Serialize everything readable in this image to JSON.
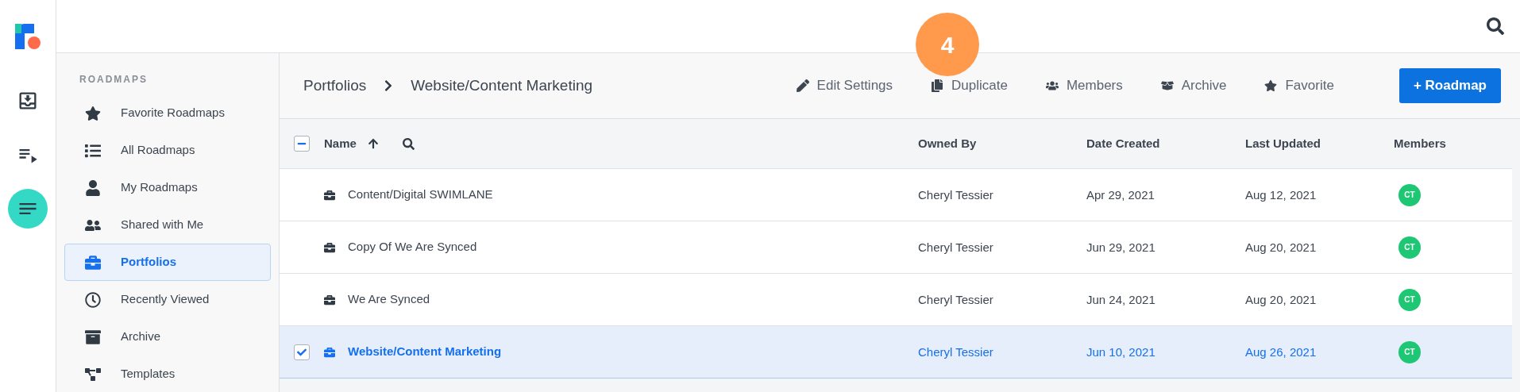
{
  "rail": [
    {
      "kind": "import",
      "selected": false
    },
    {
      "kind": "changelog",
      "selected": false
    },
    {
      "kind": "roadmaps",
      "selected": true
    }
  ],
  "sidebar": {
    "heading": "ROADMAPS",
    "items": [
      {
        "kind": "star",
        "label": "Favorite Roadmaps",
        "selected": false
      },
      {
        "kind": "list",
        "label": "All Roadmaps",
        "selected": false
      },
      {
        "kind": "user",
        "label": "My Roadmaps",
        "selected": false
      },
      {
        "kind": "users",
        "label": "Shared with Me",
        "selected": false
      },
      {
        "kind": "briefcase",
        "label": "Portfolios",
        "selected": true
      },
      {
        "kind": "clock",
        "label": "Recently Viewed",
        "selected": false
      },
      {
        "kind": "archive",
        "label": "Archive",
        "selected": false
      },
      {
        "kind": "templates",
        "label": "Templates",
        "selected": false
      }
    ]
  },
  "toolbar": {
    "breadcrumb": [
      "Portfolios",
      "Website/Content Marketing"
    ],
    "actions": [
      {
        "kind": "edit",
        "label": "Edit Settings"
      },
      {
        "kind": "duplicate",
        "label": "Duplicate"
      },
      {
        "kind": "members",
        "label": "Members"
      },
      {
        "kind": "archive",
        "label": "Archive"
      },
      {
        "kind": "favorite",
        "label": "Favorite"
      }
    ],
    "primary_button": "+ Roadmap"
  },
  "step_badge": "4",
  "table": {
    "select_all": {
      "indeterminate": true
    },
    "columns": [
      {
        "label": "Name",
        "sorted": true,
        "searchable": true
      },
      {
        "label": "Owned By",
        "sorted": false,
        "searchable": false
      },
      {
        "label": "Date Created",
        "sorted": false,
        "searchable": false
      },
      {
        "label": "Last Updated",
        "sorted": false,
        "searchable": false
      },
      {
        "label": "Members",
        "sorted": false,
        "searchable": false
      }
    ],
    "rows": [
      {
        "name": "Content/Digital SWIMLANE",
        "owner": "Cheryl Tessier",
        "created": "Apr 29, 2021",
        "updated": "Aug 12, 2021",
        "members": [
          {
            "initials": "CT",
            "color": "#1ec773"
          }
        ],
        "selected": false
      },
      {
        "name": "Copy Of We Are Synced",
        "owner": "Cheryl Tessier",
        "created": "Jun 29, 2021",
        "updated": "Aug 20, 2021",
        "members": [
          {
            "initials": "CT",
            "color": "#1ec773"
          }
        ],
        "selected": false
      },
      {
        "name": "We Are Synced",
        "owner": "Cheryl Tessier",
        "created": "Jun 24, 2021",
        "updated": "Aug 20, 2021",
        "members": [
          {
            "initials": "CT",
            "color": "#1ec773"
          }
        ],
        "selected": false
      },
      {
        "name": "Website/Content Marketing",
        "owner": "Cheryl Tessier",
        "created": "Jun 10, 2021",
        "updated": "Aug 26, 2021",
        "members": [
          {
            "initials": "CT",
            "color": "#1ec773"
          }
        ],
        "selected": true
      }
    ]
  }
}
